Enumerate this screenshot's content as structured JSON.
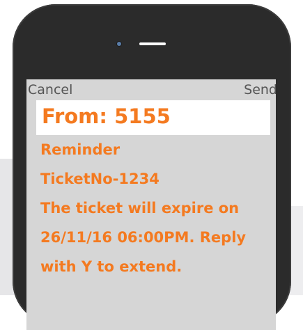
{
  "topbar": {
    "cancel_label": "Cancel",
    "send_label": "Send"
  },
  "message": {
    "from": "From: 5155",
    "lines": [
      "Reminder",
      "TicketNo-1234",
      "The ticket will expire on",
      "26/11/16 06:00PM. Reply",
      "with Y to extend."
    ]
  },
  "colors": {
    "accent": "#f47a20",
    "phone_body": "#2b2b2b",
    "screen": "#d6d6d6"
  }
}
